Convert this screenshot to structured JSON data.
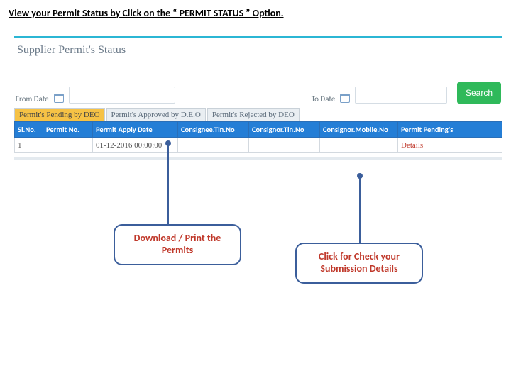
{
  "instruction": "View your Permit Status by Click on the “ PERMIT STATUS ” Option.",
  "app": {
    "title": "Supplier Permit's Status",
    "from_label": "From Date",
    "to_label": "To Date",
    "from_value": "",
    "to_value": "",
    "search_label": "Search"
  },
  "tabs": [
    {
      "label": "Permit's Pending by DEO"
    },
    {
      "label": "Permit's Approved by D.E.O"
    },
    {
      "label": "Permit's Rejected by DEO"
    }
  ],
  "table": {
    "headers": [
      "Sl.No.",
      "Permit No.",
      "Permit Apply Date",
      "Consignee.Tin.No",
      "Consignor.Tin.No",
      "Consignor.Mobile.No",
      "Permit Pending's"
    ],
    "rows": [
      {
        "slno": "1",
        "permit_no": "",
        "apply_date": "01-12-2016 00:00:00",
        "consignee_tin": "",
        "consignor_tin": "",
        "consignor_mobile": "",
        "pending": "Details"
      }
    ]
  },
  "callouts": {
    "download": "Download / Print the Permits",
    "details": "Click for Check your Submission Details"
  }
}
